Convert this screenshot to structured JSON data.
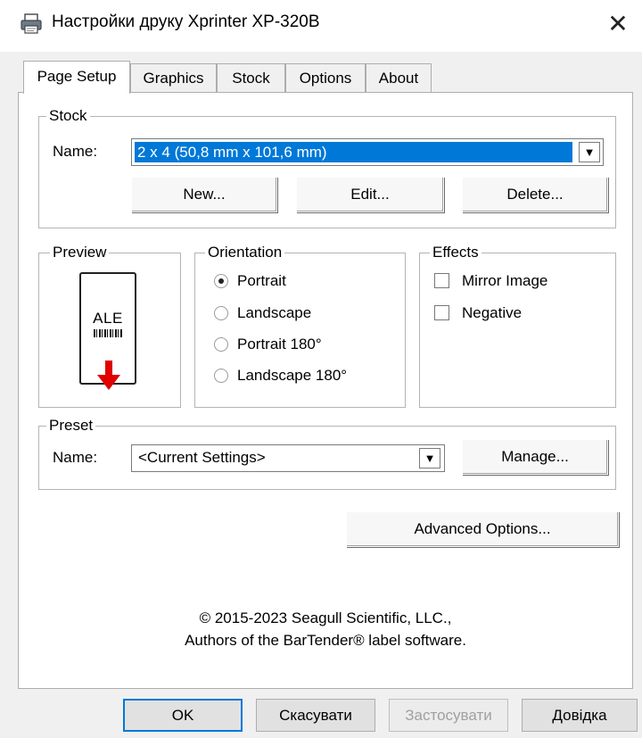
{
  "window": {
    "title": "Настройки друку Xprinter XP-320B",
    "close_symbol": "✕"
  },
  "tabs": [
    {
      "label": "Page Setup",
      "active": true
    },
    {
      "label": "Graphics",
      "active": false
    },
    {
      "label": "Stock",
      "active": false
    },
    {
      "label": "Options",
      "active": false
    },
    {
      "label": "About",
      "active": false
    }
  ],
  "stock": {
    "group_label": "Stock",
    "name_label": "Name:",
    "name_value": "2 x 4 (50,8 mm x 101,6 mm)",
    "buttons": {
      "new": "New...",
      "edit": "Edit...",
      "delete": "Delete..."
    }
  },
  "preview": {
    "group_label": "Preview",
    "sample_text": "ALE",
    "arrow_color": "#e00000"
  },
  "orientation": {
    "group_label": "Orientation",
    "options": [
      {
        "label": "Portrait",
        "selected": true
      },
      {
        "label": "Landscape",
        "selected": false
      },
      {
        "label": "Portrait 180°",
        "selected": false
      },
      {
        "label": "Landscape 180°",
        "selected": false
      }
    ]
  },
  "effects": {
    "group_label": "Effects",
    "options": [
      {
        "label": "Mirror Image",
        "checked": false
      },
      {
        "label": "Negative",
        "checked": false
      }
    ]
  },
  "preset": {
    "group_label": "Preset",
    "name_label": "Name:",
    "name_value": "<Current Settings>",
    "manage_button": "Manage..."
  },
  "advanced_button": "Advanced Options...",
  "copyright": {
    "line1": "© 2015-2023 Seagull Scientific, LLC.,",
    "line2": "Authors of the BarTender® label software."
  },
  "footer": {
    "ok": "OK",
    "cancel": "Скасувати",
    "apply": "Застосувати",
    "help": "Довідка"
  },
  "colors": {
    "accent": "#0078d7",
    "selection": "#0078d7"
  }
}
